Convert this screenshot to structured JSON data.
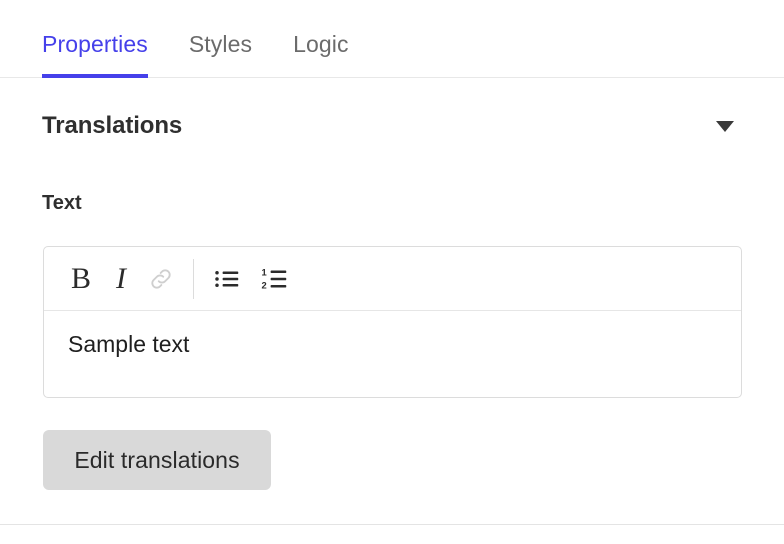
{
  "tabs": [
    {
      "label": "Properties",
      "active": true,
      "name": "tab-properties"
    },
    {
      "label": "Styles",
      "active": false,
      "name": "tab-styles"
    },
    {
      "label": "Logic",
      "active": false,
      "name": "tab-logic"
    }
  ],
  "section": {
    "title": "Translations",
    "collapse_icon": "caret-down-icon",
    "expanded": true
  },
  "field": {
    "label": "Text",
    "value": "Sample text",
    "placeholder": ""
  },
  "toolbar": {
    "items": [
      {
        "name": "bold-icon",
        "glyph": "B",
        "label": "Bold",
        "disabled": false
      },
      {
        "name": "italic-icon",
        "glyph": "I",
        "label": "Italic",
        "disabled": false
      },
      {
        "name": "link-icon",
        "glyph": "",
        "label": "Link",
        "disabled": true
      },
      {
        "name": "bulleted-list-icon",
        "glyph": "",
        "label": "Bulleted list",
        "disabled": false
      },
      {
        "name": "numbered-list-icon",
        "glyph": "",
        "label": "Numbered list",
        "disabled": false
      }
    ],
    "numbered_list_digits": [
      "1",
      "2"
    ]
  },
  "actions": {
    "edit_translations_label": "Edit translations"
  },
  "colors": {
    "accent": "#4540ea",
    "tab_inactive": "#6b6b6b",
    "heading": "#2f2f2f",
    "text": "#1f1f1f",
    "button_bg": "#d9d9d9",
    "border": "#dcdcdc",
    "icon": "#2b2b2b",
    "icon_disabled": "#cfcfcf"
  }
}
